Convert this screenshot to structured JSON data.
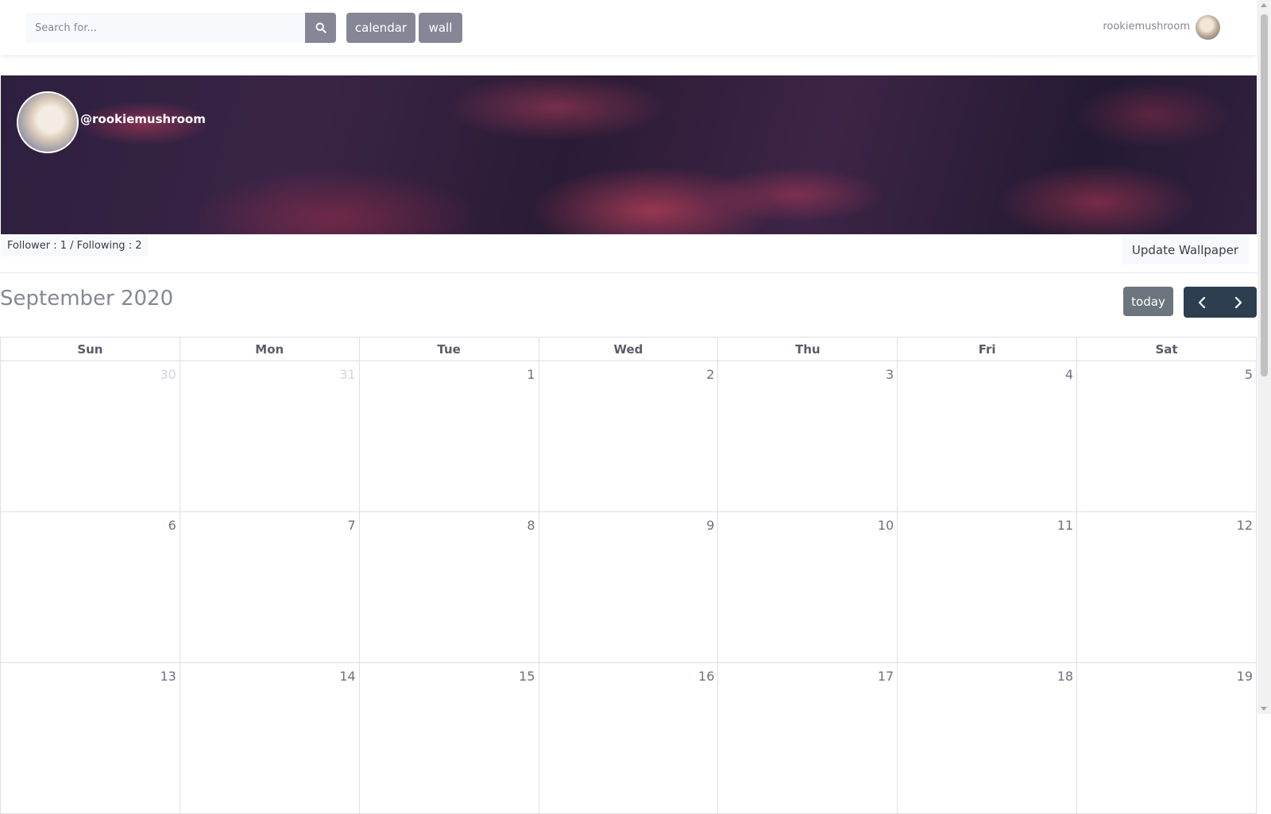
{
  "topbar": {
    "search_placeholder": "Search for...",
    "buttons": {
      "calendar": "calendar",
      "wall": "wall"
    },
    "username": "rookiemushroom",
    "icons": {
      "search": "search-icon"
    }
  },
  "profile": {
    "handle": "@rookiemushroom",
    "follow_stats": "Follower : 1 / Following : 2",
    "update_wallpaper": "Update Wallpaper"
  },
  "calendar": {
    "title": "September 2020",
    "today_label": "today",
    "weekdays": [
      "Sun",
      "Mon",
      "Tue",
      "Wed",
      "Thu",
      "Fri",
      "Sat"
    ],
    "weeks": [
      [
        {
          "d": "30",
          "other": true
        },
        {
          "d": "31",
          "other": true
        },
        {
          "d": "1"
        },
        {
          "d": "2"
        },
        {
          "d": "3"
        },
        {
          "d": "4"
        },
        {
          "d": "5"
        }
      ],
      [
        {
          "d": "6"
        },
        {
          "d": "7"
        },
        {
          "d": "8"
        },
        {
          "d": "9"
        },
        {
          "d": "10"
        },
        {
          "d": "11"
        },
        {
          "d": "12"
        }
      ],
      [
        {
          "d": "13"
        },
        {
          "d": "14"
        },
        {
          "d": "15"
        },
        {
          "d": "16"
        },
        {
          "d": "17"
        },
        {
          "d": "18"
        },
        {
          "d": "19"
        }
      ]
    ]
  },
  "colors": {
    "button_gray": "#858796",
    "nav_dark": "#2c3e50",
    "today_gray": "#6c757d"
  }
}
